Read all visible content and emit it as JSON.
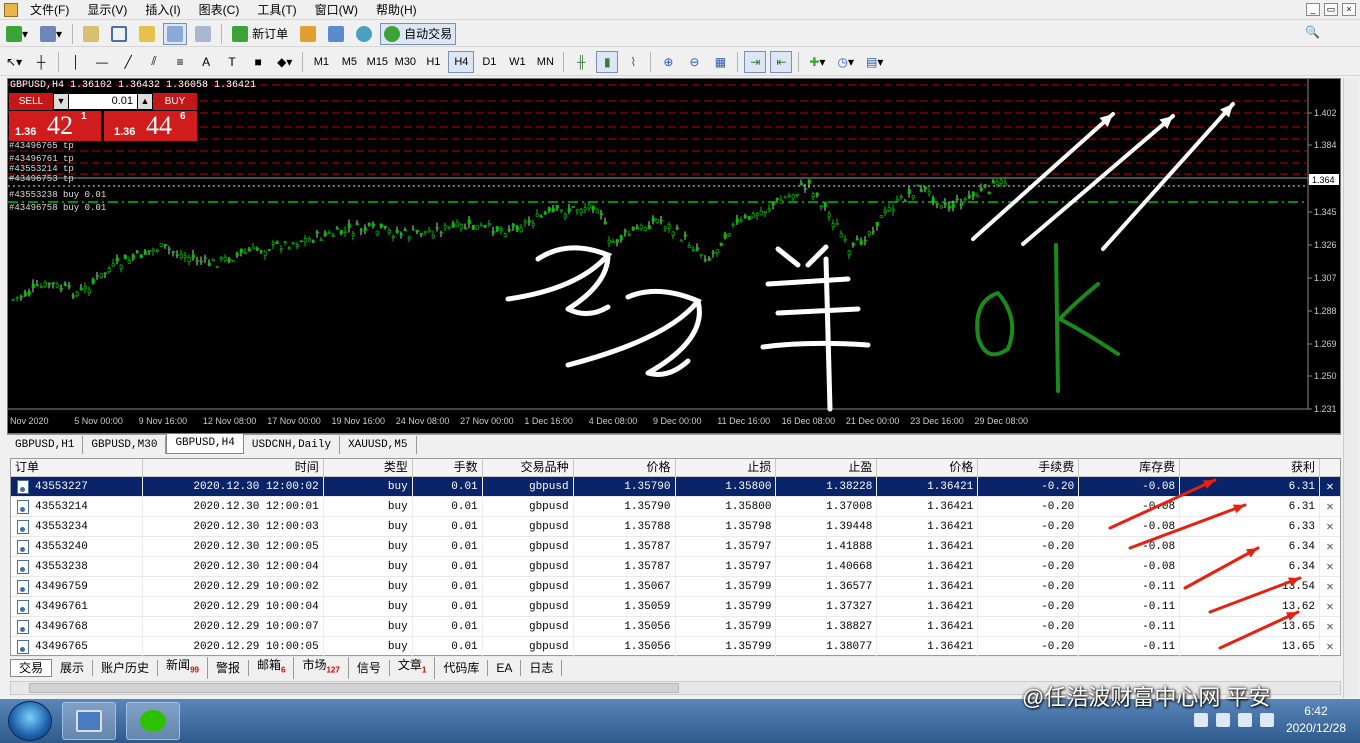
{
  "menu": [
    "文件(F)",
    "显示(V)",
    "插入(I)",
    "图表(C)",
    "工具(T)",
    "窗口(W)",
    "帮助(H)"
  ],
  "toolbar1": {
    "new_order": "新订单",
    "auto_trade": "自动交易"
  },
  "timeframes": [
    "M1",
    "M5",
    "M15",
    "M30",
    "H1",
    "H4",
    "D1",
    "W1",
    "MN"
  ],
  "timeframe_active": "H4",
  "chart": {
    "header": "GBPUSD,H4  1.36102 1.36432 1.36058 1.36421",
    "sell_label": "SELL",
    "buy_label": "BUY",
    "lot": "0.01",
    "sell_price_small": "1.36",
    "sell_price_big": "42",
    "sell_price_sup": "1",
    "buy_price_small": "1.36",
    "buy_price_big": "44",
    "buy_price_sup": "6",
    "order_labels": [
      "#43496765 tp",
      "#43496761 tp",
      "#43553214 tp",
      "#43496753 tp",
      "#43553238 buy 0.01",
      "#43496758 buy 0.01"
    ],
    "price_axis": [
      "1.402",
      "1.384",
      "1.364",
      "1.345",
      "1.326",
      "1.307",
      "1.288",
      "1.269",
      "1.250",
      "1.231"
    ],
    "time_axis": [
      "Nov 2020",
      "5 Nov 00:00",
      "9 Nov 16:00",
      "12 Nov 08:00",
      "17 Nov 00:00",
      "19 Nov 16:00",
      "24 Nov 08:00",
      "27 Nov 00:00",
      "1 Dec 16:00",
      "4 Dec 08:00",
      "9 Dec 00:00",
      "11 Dec 16:00",
      "16 Dec 08:00",
      "21 Dec 00:00",
      "23 Dec 16:00",
      "29 Dec 08:00"
    ],
    "current_price": "1.364",
    "colors": {
      "bg": "#000000",
      "up": "#00c000",
      "down": "#c8c8c8",
      "tp_line": "#c00000",
      "buy_line": "#00c000",
      "annotation_white": "#ffffff",
      "annotation_green": "#1a8a1a",
      "arrow_red": "#e82010"
    }
  },
  "chart_tabs": [
    "GBPUSD,H1",
    "GBPUSD,M30",
    "GBPUSD,H4",
    "USDCNH,Daily",
    "XAUUSD,M5"
  ],
  "chart_tab_selected": 2,
  "terminal": {
    "columns": [
      "订单",
      "时间",
      "类型",
      "手数",
      "交易品种",
      "价格",
      "止损",
      "止盈",
      "价格",
      "手续费",
      "库存费",
      "获利"
    ],
    "rows": [
      [
        "43553227",
        "2020.12.30 12:00:02",
        "buy",
        "0.01",
        "gbpusd",
        "1.35790",
        "1.35800",
        "1.38228",
        "1.36421",
        "-0.20",
        "-0.08",
        "6.31"
      ],
      [
        "43553214",
        "2020.12.30 12:00:01",
        "buy",
        "0.01",
        "gbpusd",
        "1.35790",
        "1.35800",
        "1.37008",
        "1.36421",
        "-0.20",
        "-0.08",
        "6.31"
      ],
      [
        "43553234",
        "2020.12.30 12:00:03",
        "buy",
        "0.01",
        "gbpusd",
        "1.35788",
        "1.35798",
        "1.39448",
        "1.36421",
        "-0.20",
        "-0.08",
        "6.33"
      ],
      [
        "43553240",
        "2020.12.30 12:00:05",
        "buy",
        "0.01",
        "gbpusd",
        "1.35787",
        "1.35797",
        "1.41888",
        "1.36421",
        "-0.20",
        "-0.08",
        "6.34"
      ],
      [
        "43553238",
        "2020.12.30 12:00:04",
        "buy",
        "0.01",
        "gbpusd",
        "1.35787",
        "1.35797",
        "1.40668",
        "1.36421",
        "-0.20",
        "-0.08",
        "6.34"
      ],
      [
        "43496759",
        "2020.12.29 10:00:02",
        "buy",
        "0.01",
        "gbpusd",
        "1.35067",
        "1.35799",
        "1.36577",
        "1.36421",
        "-0.20",
        "-0.11",
        "13.54"
      ],
      [
        "43496761",
        "2020.12.29 10:00:04",
        "buy",
        "0.01",
        "gbpusd",
        "1.35059",
        "1.35799",
        "1.37327",
        "1.36421",
        "-0.20",
        "-0.11",
        "13.62"
      ],
      [
        "43496768",
        "2020.12.29 10:00:07",
        "buy",
        "0.01",
        "gbpusd",
        "1.35056",
        "1.35799",
        "1.38827",
        "1.36421",
        "-0.20",
        "-0.11",
        "13.65"
      ],
      [
        "43496765",
        "2020.12.29 10:00:05",
        "buy",
        "0.01",
        "gbpusd",
        "1.35056",
        "1.35799",
        "1.38077",
        "1.36421",
        "-0.20",
        "-0.11",
        "13.65"
      ]
    ]
  },
  "bottom_tabs": [
    {
      "label": "交易",
      "badge": ""
    },
    {
      "label": "展示",
      "badge": ""
    },
    {
      "label": "账户历史",
      "badge": ""
    },
    {
      "label": "新闻",
      "badge": "99"
    },
    {
      "label": "警报",
      "badge": ""
    },
    {
      "label": "邮箱",
      "badge": "6"
    },
    {
      "label": "市场",
      "badge": "127"
    },
    {
      "label": "信号",
      "badge": ""
    },
    {
      "label": "文章",
      "badge": "1"
    },
    {
      "label": "代码库",
      "badge": ""
    },
    {
      "label": "EA",
      "badge": ""
    },
    {
      "label": "日志",
      "badge": ""
    }
  ],
  "taskbar": {
    "time": "6:42",
    "date": "2020/12/28"
  },
  "watermark": "@任浩波财富中心网 平安"
}
